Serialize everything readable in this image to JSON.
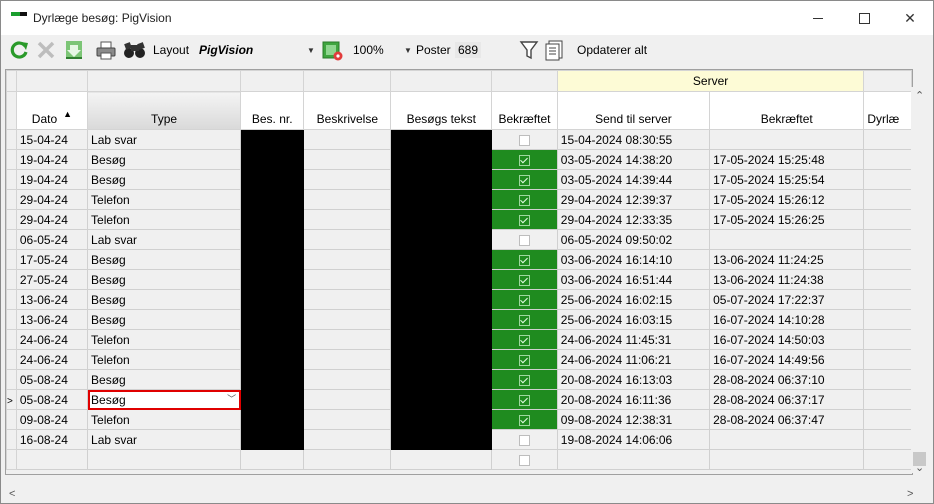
{
  "window": {
    "title": "Dyrlæge besøg: PigVision"
  },
  "toolbar": {
    "layout_label": "Layout",
    "layout_value": "PigVision",
    "zoom": "100%",
    "poster_label": "Poster",
    "poster_value": "689",
    "refresh_all_label": "Opdaterer alt"
  },
  "grid": {
    "band_server": "Server",
    "columns": {
      "dato": "Dato",
      "type": "Type",
      "bes_nr": "Bes. nr.",
      "beskrivelse": "Beskrivelse",
      "besogs_tekst": "Besøgs tekst",
      "bekraeftet": "Bekræftet",
      "send_til_server": "Send til server",
      "server_bekraeftet": "Bekræftet",
      "dyrlaege": "Dyrlæ"
    },
    "rows": [
      {
        "dato": "15-04-24",
        "type": "Lab svar",
        "bekraeftet": false,
        "send": "15-04-2024 08:30:55",
        "server_bekraeftet": ""
      },
      {
        "dato": "19-04-24",
        "type": "Besøg",
        "bekraeftet": true,
        "send": "03-05-2024 14:38:20",
        "server_bekraeftet": "17-05-2024 15:25:48"
      },
      {
        "dato": "19-04-24",
        "type": "Besøg",
        "bekraeftet": true,
        "send": "03-05-2024 14:39:44",
        "server_bekraeftet": "17-05-2024 15:25:54"
      },
      {
        "dato": "29-04-24",
        "type": "Telefon",
        "bekraeftet": true,
        "send": "29-04-2024 12:39:37",
        "server_bekraeftet": "17-05-2024 15:26:12"
      },
      {
        "dato": "29-04-24",
        "type": "Telefon",
        "bekraeftet": true,
        "send": "29-04-2024 12:33:35",
        "server_bekraeftet": "17-05-2024 15:26:25"
      },
      {
        "dato": "06-05-24",
        "type": "Lab svar",
        "bekraeftet": false,
        "send": "06-05-2024 09:50:02",
        "server_bekraeftet": ""
      },
      {
        "dato": "17-05-24",
        "type": "Besøg",
        "bekraeftet": true,
        "send": "03-06-2024 16:14:10",
        "server_bekraeftet": "13-06-2024 11:24:25"
      },
      {
        "dato": "27-05-24",
        "type": "Besøg",
        "bekraeftet": true,
        "send": "03-06-2024 16:51:44",
        "server_bekraeftet": "13-06-2024 11:24:38"
      },
      {
        "dato": "13-06-24",
        "type": "Besøg",
        "bekraeftet": true,
        "send": "25-06-2024 16:02:15",
        "server_bekraeftet": "05-07-2024 17:22:37"
      },
      {
        "dato": "13-06-24",
        "type": "Besøg",
        "bekraeftet": true,
        "send": "25-06-2024 16:03:15",
        "server_bekraeftet": "16-07-2024 14:10:28"
      },
      {
        "dato": "24-06-24",
        "type": "Telefon",
        "bekraeftet": true,
        "send": "24-06-2024 11:45:31",
        "server_bekraeftet": "16-07-2024 14:50:03"
      },
      {
        "dato": "24-06-24",
        "type": "Telefon",
        "bekraeftet": true,
        "send": "24-06-2024 11:06:21",
        "server_bekraeftet": "16-07-2024 14:49:56"
      },
      {
        "dato": "05-08-24",
        "type": "Besøg",
        "bekraeftet": true,
        "send": "20-08-2024 16:13:03",
        "server_bekraeftet": "28-08-2024 06:37:10"
      },
      {
        "dato": "05-08-24",
        "type": "Besøg",
        "bekraeftet": true,
        "send": "20-08-2024 16:11:36",
        "server_bekraeftet": "28-08-2024 06:37:17"
      },
      {
        "dato": "09-08-24",
        "type": "Telefon",
        "bekraeftet": true,
        "send": "09-08-2024 12:38:31",
        "server_bekraeftet": "28-08-2024 06:37:47"
      },
      {
        "dato": "16-08-24",
        "type": "Lab svar",
        "bekraeftet": false,
        "send": "19-08-2024 14:06:06",
        "server_bekraeftet": ""
      }
    ],
    "current_row_index": 13,
    "current_row_marker": ">"
  }
}
